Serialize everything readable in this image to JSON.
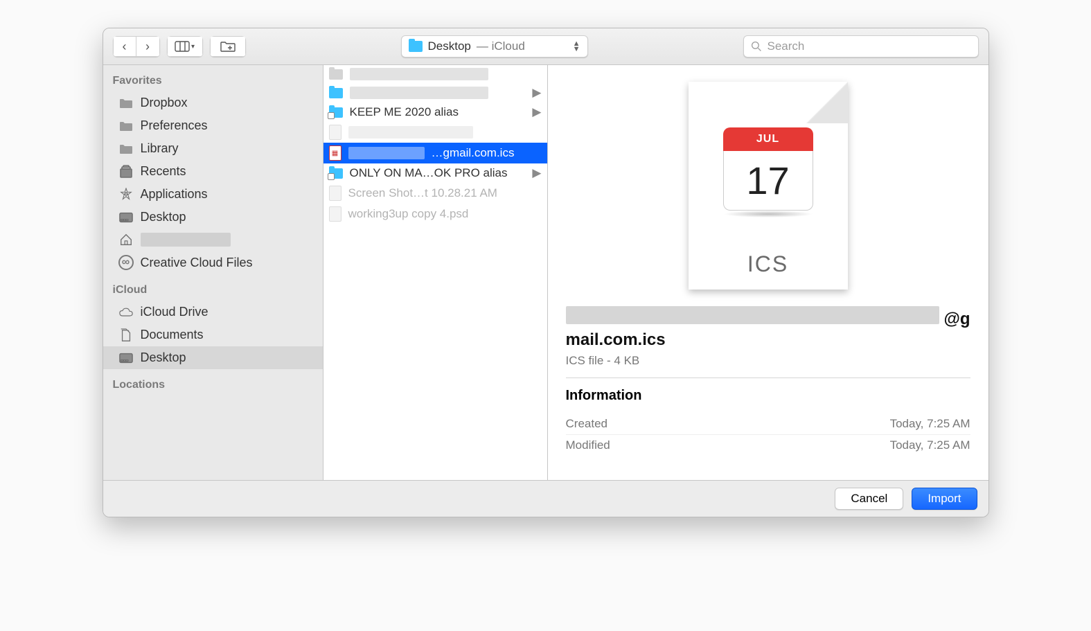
{
  "toolbar": {
    "location_folder": "Desktop",
    "location_suffix": "— iCloud",
    "search_placeholder": "Search"
  },
  "sidebar": {
    "sections": [
      {
        "title": "Favorites",
        "items": [
          {
            "label": "Dropbox",
            "icon": "folder"
          },
          {
            "label": "Preferences",
            "icon": "folder"
          },
          {
            "label": "Library",
            "icon": "folder"
          },
          {
            "label": "Recents",
            "icon": "recents"
          },
          {
            "label": "Applications",
            "icon": "apps"
          },
          {
            "label": "Desktop",
            "icon": "desktop"
          },
          {
            "label": "",
            "icon": "home",
            "redacted": true
          },
          {
            "label": "Creative Cloud Files",
            "icon": "cc"
          }
        ]
      },
      {
        "title": "iCloud",
        "items": [
          {
            "label": "iCloud Drive",
            "icon": "cloud"
          },
          {
            "label": "Documents",
            "icon": "docs"
          },
          {
            "label": "Desktop",
            "icon": "desktop",
            "selected": true
          }
        ]
      },
      {
        "title": "Locations",
        "items": []
      }
    ]
  },
  "files": [
    {
      "name": "",
      "kind": "folder",
      "redacted": true,
      "hasChildren": false,
      "dim": true
    },
    {
      "name": "",
      "kind": "folder",
      "redacted": true,
      "hasChildren": true
    },
    {
      "name": "KEEP ME 2020 alias",
      "kind": "alias-folder",
      "hasChildren": true
    },
    {
      "name": "",
      "kind": "file",
      "redacted": true,
      "dim": true
    },
    {
      "name": "…gmail.com.ics",
      "kind": "ics",
      "selected": true,
      "redactPrefix": true
    },
    {
      "name": "ONLY ON MA…OK PRO alias",
      "kind": "alias-folder",
      "hasChildren": true
    },
    {
      "name": "Screen Shot…t 10.28.21 AM",
      "kind": "png",
      "dim": true
    },
    {
      "name": "working3up copy 4.psd",
      "kind": "psd",
      "dim": true
    }
  ],
  "preview": {
    "icon_month": "JUL",
    "icon_day": "17",
    "icon_ext": "ICS",
    "title_suffix_line1": "@g",
    "title_line2": "mail.com.ics",
    "sub": "ICS file - 4 KB",
    "info_header": "Information",
    "created_label": "Created",
    "created_value": "Today, 7:25 AM",
    "modified_label": "Modified",
    "modified_value": "Today, 7:25 AM"
  },
  "footer": {
    "cancel": "Cancel",
    "import": "Import"
  }
}
